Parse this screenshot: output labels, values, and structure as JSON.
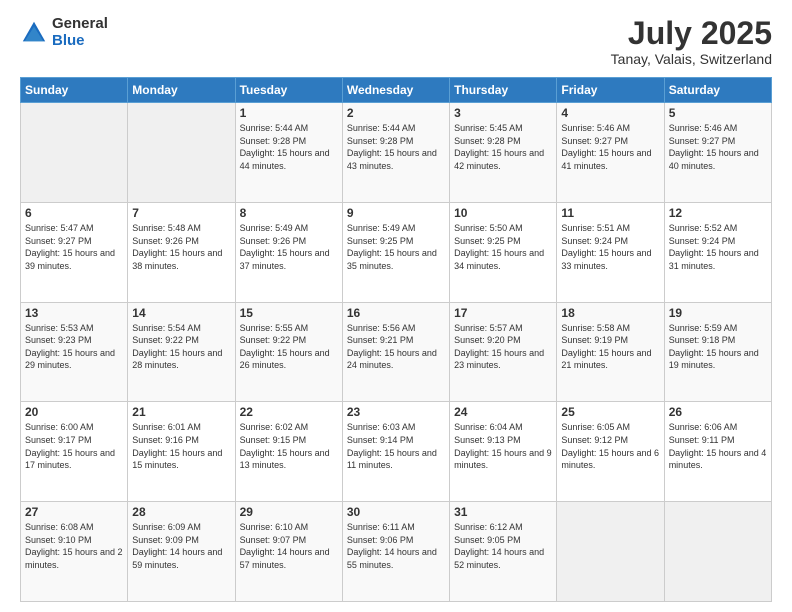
{
  "logo": {
    "general": "General",
    "blue": "Blue"
  },
  "title": "July 2025",
  "subtitle": "Tanay, Valais, Switzerland",
  "days_of_week": [
    "Sunday",
    "Monday",
    "Tuesday",
    "Wednesday",
    "Thursday",
    "Friday",
    "Saturday"
  ],
  "weeks": [
    [
      {
        "day": "",
        "sunrise": "",
        "sunset": "",
        "daylight": "",
        "empty": true
      },
      {
        "day": "",
        "sunrise": "",
        "sunset": "",
        "daylight": "",
        "empty": true
      },
      {
        "day": "1",
        "sunrise": "Sunrise: 5:44 AM",
        "sunset": "Sunset: 9:28 PM",
        "daylight": "Daylight: 15 hours and 44 minutes.",
        "empty": false
      },
      {
        "day": "2",
        "sunrise": "Sunrise: 5:44 AM",
        "sunset": "Sunset: 9:28 PM",
        "daylight": "Daylight: 15 hours and 43 minutes.",
        "empty": false
      },
      {
        "day": "3",
        "sunrise": "Sunrise: 5:45 AM",
        "sunset": "Sunset: 9:28 PM",
        "daylight": "Daylight: 15 hours and 42 minutes.",
        "empty": false
      },
      {
        "day": "4",
        "sunrise": "Sunrise: 5:46 AM",
        "sunset": "Sunset: 9:27 PM",
        "daylight": "Daylight: 15 hours and 41 minutes.",
        "empty": false
      },
      {
        "day": "5",
        "sunrise": "Sunrise: 5:46 AM",
        "sunset": "Sunset: 9:27 PM",
        "daylight": "Daylight: 15 hours and 40 minutes.",
        "empty": false
      }
    ],
    [
      {
        "day": "6",
        "sunrise": "Sunrise: 5:47 AM",
        "sunset": "Sunset: 9:27 PM",
        "daylight": "Daylight: 15 hours and 39 minutes.",
        "empty": false
      },
      {
        "day": "7",
        "sunrise": "Sunrise: 5:48 AM",
        "sunset": "Sunset: 9:26 PM",
        "daylight": "Daylight: 15 hours and 38 minutes.",
        "empty": false
      },
      {
        "day": "8",
        "sunrise": "Sunrise: 5:49 AM",
        "sunset": "Sunset: 9:26 PM",
        "daylight": "Daylight: 15 hours and 37 minutes.",
        "empty": false
      },
      {
        "day": "9",
        "sunrise": "Sunrise: 5:49 AM",
        "sunset": "Sunset: 9:25 PM",
        "daylight": "Daylight: 15 hours and 35 minutes.",
        "empty": false
      },
      {
        "day": "10",
        "sunrise": "Sunrise: 5:50 AM",
        "sunset": "Sunset: 9:25 PM",
        "daylight": "Daylight: 15 hours and 34 minutes.",
        "empty": false
      },
      {
        "day": "11",
        "sunrise": "Sunrise: 5:51 AM",
        "sunset": "Sunset: 9:24 PM",
        "daylight": "Daylight: 15 hours and 33 minutes.",
        "empty": false
      },
      {
        "day": "12",
        "sunrise": "Sunrise: 5:52 AM",
        "sunset": "Sunset: 9:24 PM",
        "daylight": "Daylight: 15 hours and 31 minutes.",
        "empty": false
      }
    ],
    [
      {
        "day": "13",
        "sunrise": "Sunrise: 5:53 AM",
        "sunset": "Sunset: 9:23 PM",
        "daylight": "Daylight: 15 hours and 29 minutes.",
        "empty": false
      },
      {
        "day": "14",
        "sunrise": "Sunrise: 5:54 AM",
        "sunset": "Sunset: 9:22 PM",
        "daylight": "Daylight: 15 hours and 28 minutes.",
        "empty": false
      },
      {
        "day": "15",
        "sunrise": "Sunrise: 5:55 AM",
        "sunset": "Sunset: 9:22 PM",
        "daylight": "Daylight: 15 hours and 26 minutes.",
        "empty": false
      },
      {
        "day": "16",
        "sunrise": "Sunrise: 5:56 AM",
        "sunset": "Sunset: 9:21 PM",
        "daylight": "Daylight: 15 hours and 24 minutes.",
        "empty": false
      },
      {
        "day": "17",
        "sunrise": "Sunrise: 5:57 AM",
        "sunset": "Sunset: 9:20 PM",
        "daylight": "Daylight: 15 hours and 23 minutes.",
        "empty": false
      },
      {
        "day": "18",
        "sunrise": "Sunrise: 5:58 AM",
        "sunset": "Sunset: 9:19 PM",
        "daylight": "Daylight: 15 hours and 21 minutes.",
        "empty": false
      },
      {
        "day": "19",
        "sunrise": "Sunrise: 5:59 AM",
        "sunset": "Sunset: 9:18 PM",
        "daylight": "Daylight: 15 hours and 19 minutes.",
        "empty": false
      }
    ],
    [
      {
        "day": "20",
        "sunrise": "Sunrise: 6:00 AM",
        "sunset": "Sunset: 9:17 PM",
        "daylight": "Daylight: 15 hours and 17 minutes.",
        "empty": false
      },
      {
        "day": "21",
        "sunrise": "Sunrise: 6:01 AM",
        "sunset": "Sunset: 9:16 PM",
        "daylight": "Daylight: 15 hours and 15 minutes.",
        "empty": false
      },
      {
        "day": "22",
        "sunrise": "Sunrise: 6:02 AM",
        "sunset": "Sunset: 9:15 PM",
        "daylight": "Daylight: 15 hours and 13 minutes.",
        "empty": false
      },
      {
        "day": "23",
        "sunrise": "Sunrise: 6:03 AM",
        "sunset": "Sunset: 9:14 PM",
        "daylight": "Daylight: 15 hours and 11 minutes.",
        "empty": false
      },
      {
        "day": "24",
        "sunrise": "Sunrise: 6:04 AM",
        "sunset": "Sunset: 9:13 PM",
        "daylight": "Daylight: 15 hours and 9 minutes.",
        "empty": false
      },
      {
        "day": "25",
        "sunrise": "Sunrise: 6:05 AM",
        "sunset": "Sunset: 9:12 PM",
        "daylight": "Daylight: 15 hours and 6 minutes.",
        "empty": false
      },
      {
        "day": "26",
        "sunrise": "Sunrise: 6:06 AM",
        "sunset": "Sunset: 9:11 PM",
        "daylight": "Daylight: 15 hours and 4 minutes.",
        "empty": false
      }
    ],
    [
      {
        "day": "27",
        "sunrise": "Sunrise: 6:08 AM",
        "sunset": "Sunset: 9:10 PM",
        "daylight": "Daylight: 15 hours and 2 minutes.",
        "empty": false
      },
      {
        "day": "28",
        "sunrise": "Sunrise: 6:09 AM",
        "sunset": "Sunset: 9:09 PM",
        "daylight": "Daylight: 14 hours and 59 minutes.",
        "empty": false
      },
      {
        "day": "29",
        "sunrise": "Sunrise: 6:10 AM",
        "sunset": "Sunset: 9:07 PM",
        "daylight": "Daylight: 14 hours and 57 minutes.",
        "empty": false
      },
      {
        "day": "30",
        "sunrise": "Sunrise: 6:11 AM",
        "sunset": "Sunset: 9:06 PM",
        "daylight": "Daylight: 14 hours and 55 minutes.",
        "empty": false
      },
      {
        "day": "31",
        "sunrise": "Sunrise: 6:12 AM",
        "sunset": "Sunset: 9:05 PM",
        "daylight": "Daylight: 14 hours and 52 minutes.",
        "empty": false
      },
      {
        "day": "",
        "sunrise": "",
        "sunset": "",
        "daylight": "",
        "empty": true
      },
      {
        "day": "",
        "sunrise": "",
        "sunset": "",
        "daylight": "",
        "empty": true
      }
    ]
  ]
}
